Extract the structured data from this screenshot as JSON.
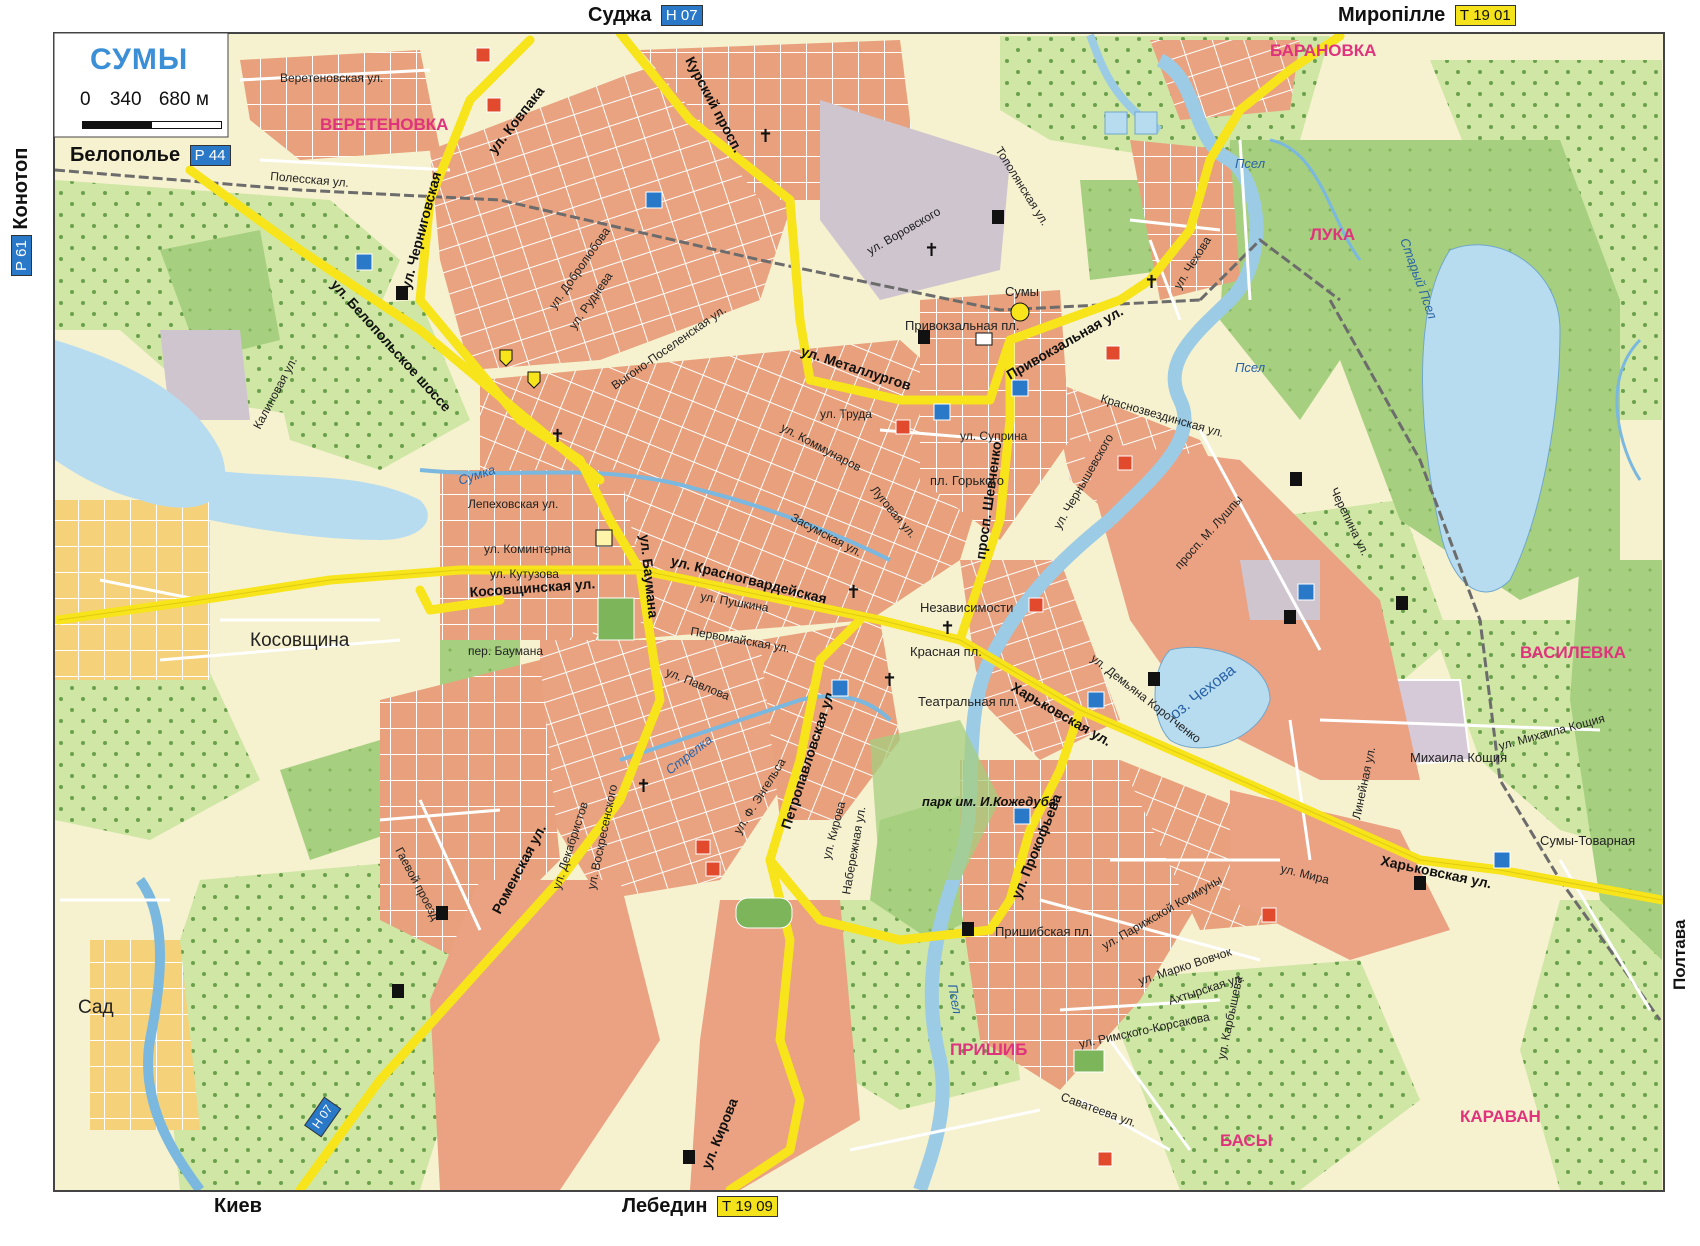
{
  "map_title": "СУМЫ",
  "scale": {
    "zero": "0",
    "mid": "340",
    "end": "680 м"
  },
  "edges": {
    "top": [
      {
        "name": "Суджа",
        "route": "Н 07",
        "shield": "blue"
      },
      {
        "name": "Миропілле",
        "route": "Т 19 01",
        "shield": "yellow"
      }
    ],
    "bottom": [
      {
        "name": "Киев"
      },
      {
        "name": "Лебедин",
        "route": "Т 19 09",
        "shield": "yellow"
      }
    ],
    "left": [
      {
        "name": "Белополье",
        "route": "Р 44",
        "shield": "blue"
      },
      {
        "name": "Конотоп",
        "route": "Р 61",
        "shield": "blue"
      }
    ],
    "right": [
      {
        "name": "Полтава"
      }
    ]
  },
  "districts": [
    "ВЕРЕТЕНОВКА",
    "БАРАНОВКА",
    "ЛУКА",
    "ВАСИЛЕВКА",
    "ПРИШИБ",
    "КАРАВАН",
    "БАСЫ",
    "Косовщина",
    "Сад"
  ],
  "roads": {
    "major": [
      "ул. Ковпака",
      "Курский просп.",
      "ул. Металлургов",
      "ул. Белопольское шоссе",
      "ул. Черниговская",
      "просп. Шевченко",
      "Привокзальная ул.",
      "Косовщинская ул.",
      "ул. Баумана",
      "ул. Красногвардейская",
      "Харьковская ул.",
      "Роменская ул.",
      "ул. Кирова",
      "Петропавловская ул.",
      "ул. Прокофьева"
    ],
    "minor": [
      "Веретеновская ул.",
      "Полесская ул.",
      "ул. Чехова",
      "ул. Воровского",
      "Тополянская ул.",
      "ул. Добролюбова",
      "ул. Руднева",
      "Выгоно-Поселенская ул.",
      "Калиновая ул.",
      "ул. Труда",
      "ул. Суприна",
      "Краснозвездинская ул.",
      "Лепеховская ул.",
      "ул. Коминтерна",
      "ул. Кутузова",
      "ул. Пушкина",
      "Первомайская ул.",
      "пер. Баумана",
      "ул. Павлова",
      "Засумская ул.",
      "Луговая ул.",
      "ул. Коммунаров",
      "ул. Декабристов",
      "ул. Воскресенского",
      "Гаевой проезд",
      "ул. Ф. Энгельса",
      "ул. Кирова",
      "Набережная ул.",
      "ул. Мира",
      "ул. Парижской Коммуны",
      "ул. Марко Вовчок",
      "Ахтырская ул.",
      "ул. Римского-Корсакова",
      "ул. Карбышева",
      "Саватеева ул.",
      "Линейная ул.",
      "ул. Михаила Кощия",
      "Черепина ул.",
      "ул. Демьяна Коротченко",
      "просп. М. Лушпы",
      "ул. Чернышевского"
    ],
    "places": [
      "Сумы",
      "Привокзальная пл.",
      "пл. Горького",
      "Независимости",
      "Красная пл.",
      "Театральная пл.",
      "Пришибская пл.",
      "Михаила Кощия",
      "Сумы-Товарная",
      "оз. Чехова",
      "Псел",
      "Сумка",
      "Стрелка",
      "Старый Псел"
    ],
    "park": "парк им. И.Кожедуба"
  },
  "colors": {
    "urban": "#e8a17c",
    "pink": "#f2b7a0",
    "forest": "#a6cf7f",
    "meadow": "#cfe6a5",
    "field": "#f6f1cf",
    "water": "#b8dcef",
    "road_major": "#f7e41a",
    "road_minor": "#ffffff",
    "rail": "#6c6c6c"
  }
}
